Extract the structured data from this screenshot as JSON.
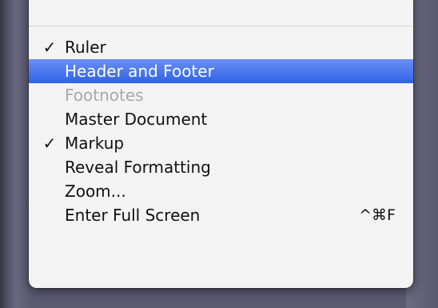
{
  "menu": {
    "items": [
      {
        "label": "Ruler",
        "checked": "✓",
        "state": "normal"
      },
      {
        "label": "Header and Footer",
        "checked": "",
        "state": "selected"
      },
      {
        "label": "Footnotes",
        "checked": "",
        "state": "disabled"
      },
      {
        "label": "Master Document",
        "checked": "",
        "state": "normal"
      },
      {
        "label": "Markup",
        "checked": "✓",
        "state": "normal"
      },
      {
        "label": "Reveal Formatting",
        "checked": "",
        "state": "normal"
      },
      {
        "label": "Zoom...",
        "checked": "",
        "state": "normal"
      },
      {
        "label": "Enter Full Screen",
        "checked": "",
        "state": "normal",
        "shortcut": "^⌘F"
      }
    ]
  },
  "colors": {
    "highlight": "#2e63e6",
    "menu_background": "#f3f3f3",
    "disabled_text": "#a9a9a9"
  },
  "icons": {
    "check": "checkmark-icon"
  }
}
